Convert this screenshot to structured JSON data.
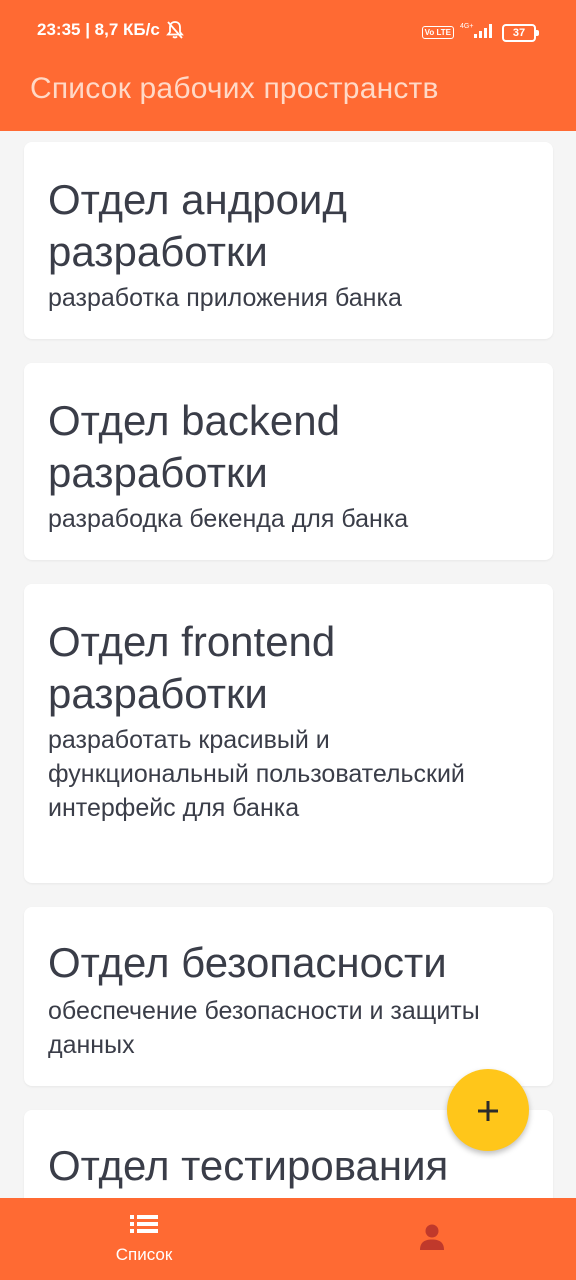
{
  "status_bar": {
    "time_speed": "23:35 | 8,7 КБ/с",
    "volte": "Vo LTE",
    "network": "4G+",
    "battery": "37"
  },
  "header": {
    "title": "Список рабочих пространств"
  },
  "workspaces": [
    {
      "title": "Отдел андроид разработки",
      "description": "разработка приложения банка"
    },
    {
      "title": "Отдел backend разработки",
      "description": "разрабодка бекенда для банка"
    },
    {
      "title": "Отдел frontend разработки",
      "description": "разработать красивый и функциональный пользовательский интерфейс для банка"
    },
    {
      "title": "Отдел безопасности",
      "description": "обеспечение безопасности и защиты данных"
    },
    {
      "title": "Отдел тестирования",
      "description": ""
    }
  ],
  "fab": {
    "icon": "plus-icon",
    "label": "+"
  },
  "bottom_nav": {
    "items": [
      {
        "label": "Список",
        "icon": "list-icon"
      },
      {
        "label": "",
        "icon": "profile-icon"
      }
    ]
  },
  "colors": {
    "accent": "#ff6a33",
    "fab": "#ffc61a",
    "background": "#f5f5f5",
    "card": "#ffffff",
    "text": "#3a3d48"
  }
}
